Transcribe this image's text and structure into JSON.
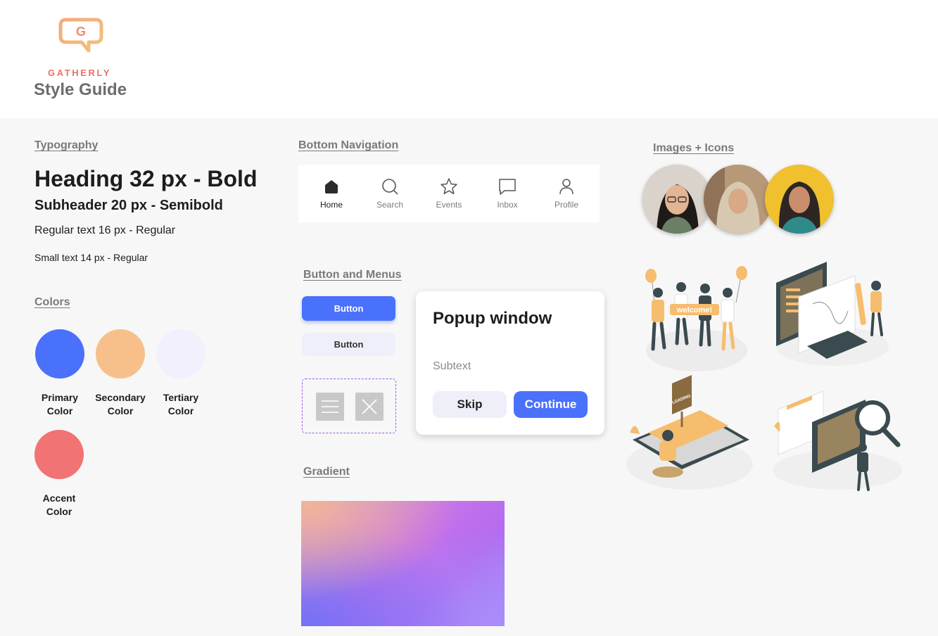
{
  "header": {
    "brand": "GATHERLY",
    "title": "Style Guide",
    "logo_letter": "G"
  },
  "typography": {
    "label": "Typography",
    "heading": "Heading 32 px - Bold",
    "subheader": "Subheader 20 px - Semibold",
    "regular": "Regular text 16 px - Regular",
    "small": "Small text 14 px - Regular"
  },
  "colors": {
    "label": "Colors",
    "swatches": [
      {
        "line1": "Primary",
        "line2": "Color",
        "hex": "#4a71fb"
      },
      {
        "line1": "Secondary",
        "line2": "Color",
        "hex": "#f7c08a"
      },
      {
        "line1": "Tertiary",
        "line2": "Color",
        "hex": "#f2f0fc"
      },
      {
        "line1": "Accent",
        "line2": "Color",
        "hex": "#f17373"
      }
    ]
  },
  "bottom_nav": {
    "label": "Bottom Navigation",
    "items": [
      {
        "label": "Home",
        "icon": "home-icon",
        "active": true
      },
      {
        "label": "Search",
        "icon": "search-icon",
        "active": false
      },
      {
        "label": "Events",
        "icon": "star-icon",
        "active": false
      },
      {
        "label": "Inbox",
        "icon": "chat-icon",
        "active": false
      },
      {
        "label": "Profile",
        "icon": "user-icon",
        "active": false
      }
    ]
  },
  "buttons": {
    "label": "Button and Menus",
    "primary_label": "Button",
    "secondary_label": "Button",
    "icons": [
      "menu-icon",
      "close-icon"
    ]
  },
  "popup": {
    "title": "Popup window",
    "subtext": "Subtext",
    "skip": "Skip",
    "continue": "Continue"
  },
  "gradient": {
    "label": "Gradient"
  },
  "images": {
    "label": "Images + Icons",
    "illustration_text": "welcome!",
    "sign_text": "LOADING"
  }
}
